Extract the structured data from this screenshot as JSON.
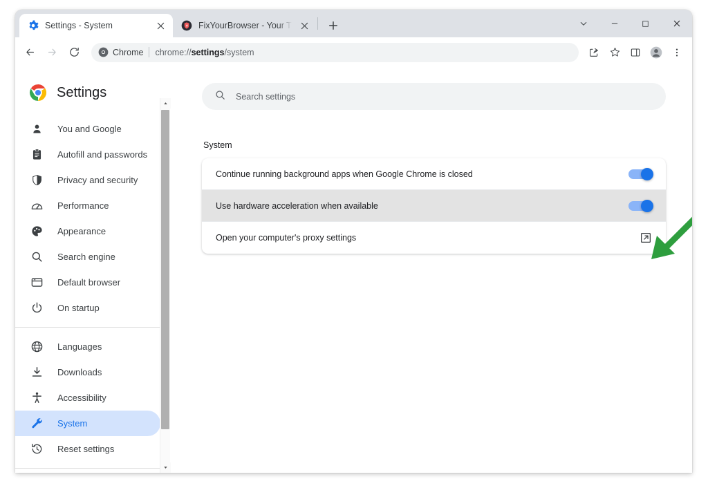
{
  "window": {
    "controls": [
      {
        "name": "tab-search",
        "glyph": "chevron-down"
      },
      {
        "name": "minimize",
        "glyph": "minimize"
      },
      {
        "name": "maximize",
        "glyph": "maximize"
      },
      {
        "name": "close",
        "glyph": "close"
      }
    ]
  },
  "tabs": [
    {
      "title": "Settings - System",
      "favicon": "settings-gear-icon",
      "active": true,
      "close_label": "Close tab"
    },
    {
      "title": "FixYourBrowser - Your Trusted So",
      "favicon": "fixyourbrowser-shield-icon",
      "active": false,
      "close_label": "Close tab"
    }
  ],
  "new_tab_label": "New tab",
  "toolbar": {
    "back_label": "Back",
    "forward_label": "Forward",
    "reload_label": "Reload",
    "omnibox": {
      "chip_label": "Chrome",
      "url_prefix": "chrome://",
      "url_bold": "settings",
      "url_suffix": "/system"
    },
    "actions": [
      {
        "name": "share-icon",
        "label": "Share this page"
      },
      {
        "name": "bookmark-star-icon",
        "label": "Bookmark this tab"
      },
      {
        "name": "side-panel-icon",
        "label": "Side panel"
      },
      {
        "name": "profile-avatar-icon",
        "label": "Profile"
      },
      {
        "name": "more-menu-icon",
        "label": "Customize and control Google Chrome"
      }
    ]
  },
  "settings": {
    "title": "Settings",
    "logo_name": "chrome-logo-icon",
    "search": {
      "placeholder": "Search settings",
      "icon": "search-icon"
    },
    "nav_groups": [
      {
        "items": [
          {
            "label": "You and Google",
            "icon": "person-icon",
            "selected": false
          },
          {
            "label": "Autofill and passwords",
            "icon": "clipboard-icon",
            "selected": false
          },
          {
            "label": "Privacy and security",
            "icon": "shield-icon",
            "selected": false
          },
          {
            "label": "Performance",
            "icon": "gauge-icon",
            "selected": false
          },
          {
            "label": "Appearance",
            "icon": "palette-icon",
            "selected": false
          },
          {
            "label": "Search engine",
            "icon": "magnifier-icon",
            "selected": false
          },
          {
            "label": "Default browser",
            "icon": "browser-window-icon",
            "selected": false
          },
          {
            "label": "On startup",
            "icon": "power-icon",
            "selected": false
          }
        ]
      },
      {
        "items": [
          {
            "label": "Languages",
            "icon": "globe-icon",
            "selected": false
          },
          {
            "label": "Downloads",
            "icon": "download-icon",
            "selected": false
          },
          {
            "label": "Accessibility",
            "icon": "accessibility-icon",
            "selected": false
          },
          {
            "label": "System",
            "icon": "wrench-icon",
            "selected": true
          },
          {
            "label": "Reset settings",
            "icon": "history-restore-icon",
            "selected": false
          }
        ]
      }
    ],
    "section": {
      "heading": "System",
      "rows": [
        {
          "label": "Continue running background apps when Google Chrome is closed",
          "control": "toggle",
          "toggle_on": true,
          "highlighted": false
        },
        {
          "label": "Use hardware acceleration when available",
          "control": "toggle",
          "toggle_on": true,
          "highlighted": true
        },
        {
          "label": "Open your computer's proxy settings",
          "control": "external-link",
          "highlighted": false
        }
      ]
    }
  },
  "annotation": {
    "arrow": {
      "name": "green-arrow-annotation",
      "color": "#2e9e3e",
      "points_to": "Use hardware acceleration when available toggle"
    }
  },
  "colors": {
    "accent_blue": "#1a73e8",
    "toggle_track": "#8ab4f8",
    "selected_nav_bg": "#d3e3fd",
    "tabstrip_bg": "#dee1e6",
    "row_highlight": "#e3e3e3",
    "annotation_green": "#2e9e3e"
  }
}
